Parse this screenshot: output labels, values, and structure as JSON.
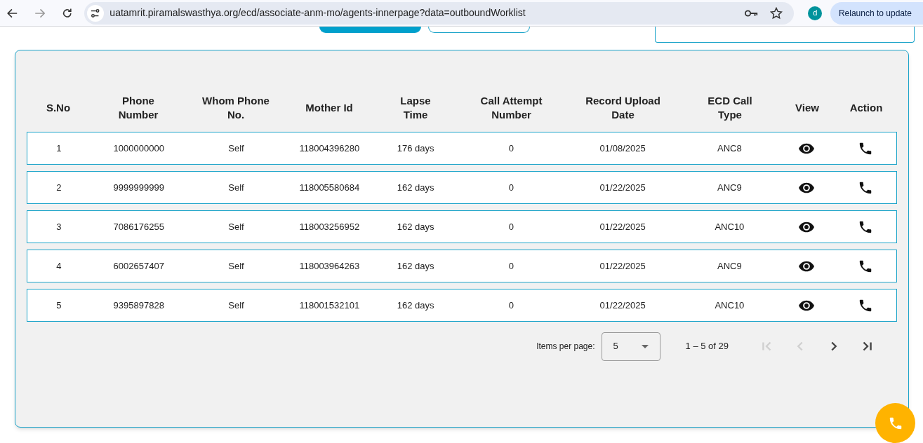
{
  "browser": {
    "url": "uatamrit.piramalswasthya.org/ecd/associate-anm-mo/agents-innerpage?data=outboundWorklist",
    "profile_initial": "d",
    "relaunch_label": "Relaunch to update"
  },
  "table": {
    "columns": [
      "S.No",
      "Phone Number",
      "Whom Phone No.",
      "Mother Id",
      "Lapse Time",
      "Call Attempt Number",
      "Record Upload Date",
      "ECD Call Type",
      "View",
      "Action"
    ],
    "rows": [
      {
        "cells": [
          "1",
          "1000000000",
          "Self",
          "118004396280",
          "176 days",
          "0",
          "01/08/2025",
          "ANC8"
        ]
      },
      {
        "cells": [
          "2",
          "9999999999",
          "Self",
          "118005580684",
          "162 days",
          "0",
          "01/22/2025",
          "ANC9"
        ]
      },
      {
        "cells": [
          "3",
          "7086176255",
          "Self",
          "118003256952",
          "162 days",
          "0",
          "01/22/2025",
          "ANC10"
        ]
      },
      {
        "cells": [
          "4",
          "6002657407",
          "Self",
          "118003964263",
          "162 days",
          "0",
          "01/22/2025",
          "ANC9"
        ]
      },
      {
        "cells": [
          "5",
          "9395897828",
          "Self",
          "118001532101",
          "162 days",
          "0",
          "01/22/2025",
          "ANC10"
        ]
      }
    ]
  },
  "paginator": {
    "items_per_page_label": "Items per page:",
    "page_size": "5",
    "range": "1 – 5 of 29",
    "buttons": [
      {
        "kind": "first",
        "disabled": true
      },
      {
        "kind": "prev",
        "disabled": true
      },
      {
        "kind": "next",
        "disabled": false
      },
      {
        "kind": "last",
        "disabled": false
      }
    ]
  }
}
